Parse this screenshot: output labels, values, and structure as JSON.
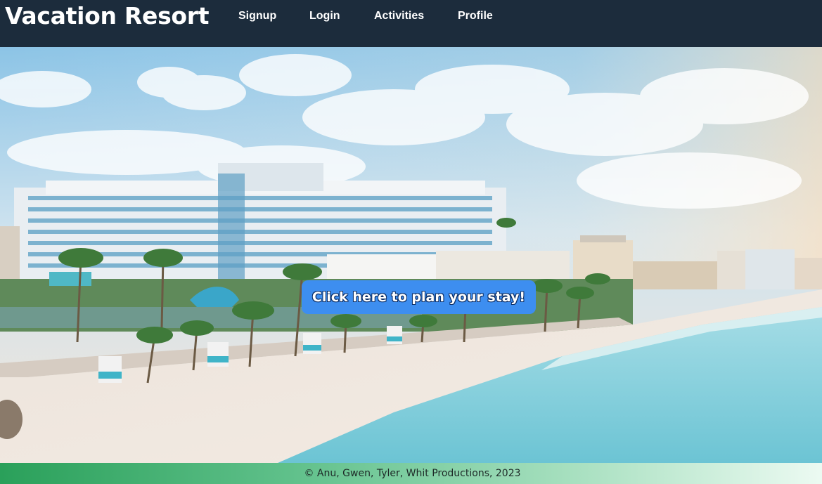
{
  "nav": {
    "brand": "Vacation Resort",
    "links": [
      {
        "label": "Signup"
      },
      {
        "label": "Login"
      },
      {
        "label": "Activities"
      },
      {
        "label": "Profile"
      }
    ]
  },
  "hero": {
    "image_subject": "beachfront resort hotel with palm trees and ocean",
    "cta_label": "Click here to plan your stay!"
  },
  "footer": {
    "text": "© Anu, Gwen, Tyler, Whit Productions, 2023"
  },
  "colors": {
    "navbar": "#1c2c3c",
    "cta": "#3d8ef0",
    "footer_start": "#2aa05a",
    "footer_end": "#ecfaf2"
  }
}
